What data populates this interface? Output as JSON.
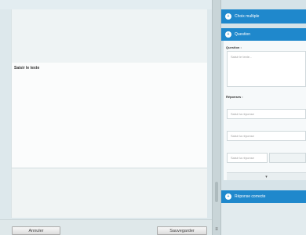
{
  "editor": {
    "canvas_text": "Saisir le texte"
  },
  "buttons": {
    "cancel": "Annuler",
    "save": "Sauvegarder"
  },
  "panel": {
    "header1": "Choix multiple",
    "header2": "Question",
    "question_label": "Question :",
    "question_placeholder": "Saisir le texte...",
    "responses_label": "Réponses :",
    "response1_placeholder": "Saisir la réponse",
    "response2_placeholder": "Saisir la réponse",
    "response3_placeholder": "Saisir la réponse",
    "footer_symbol": "▾",
    "header3": "Réponse correcte"
  },
  "colors": {
    "accent": "#1f88cc",
    "panel_bg": "#d6e3e8"
  },
  "icons": {
    "header": "plus-circle-icon",
    "splitter": "menu-icon"
  }
}
